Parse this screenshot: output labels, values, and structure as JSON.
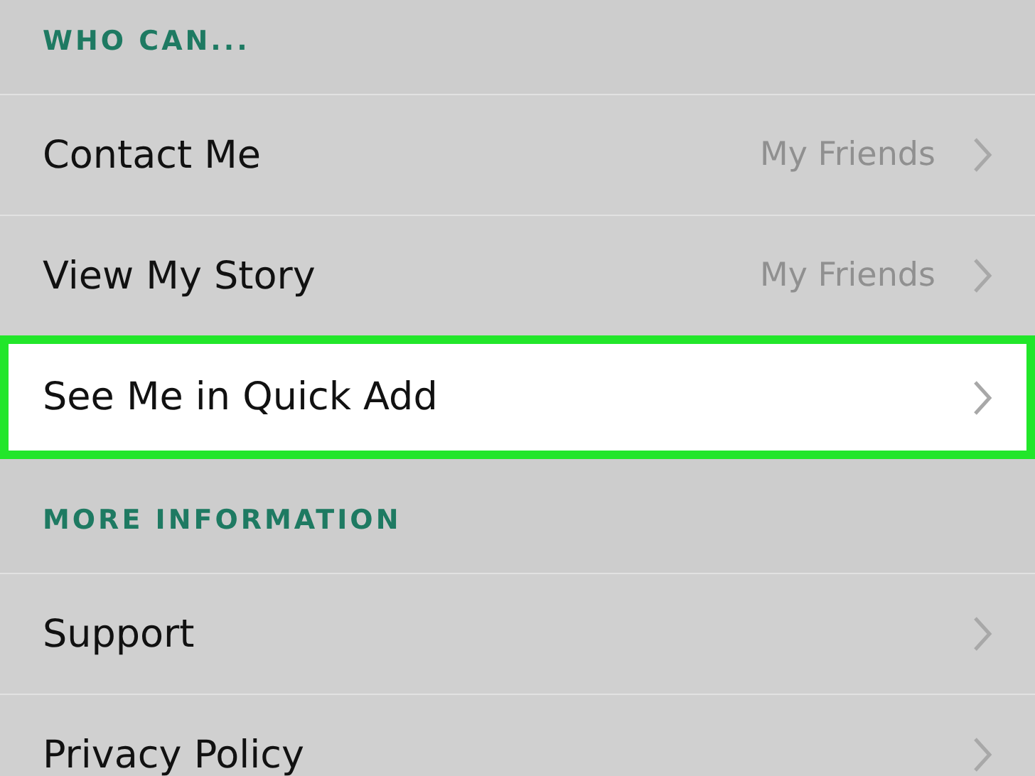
{
  "sections": [
    {
      "header": "WHO CAN...",
      "rows": [
        {
          "label": "Contact Me",
          "value": "My Friends",
          "highlighted": false
        },
        {
          "label": "View My Story",
          "value": "My Friends",
          "highlighted": false
        },
        {
          "label": "See Me in Quick Add",
          "highlighted": true
        }
      ]
    },
    {
      "header": "MORE INFORMATION",
      "rows": [
        {
          "label": "Support",
          "highlighted": false
        },
        {
          "label": "Privacy Policy",
          "highlighted": false
        }
      ]
    }
  ]
}
